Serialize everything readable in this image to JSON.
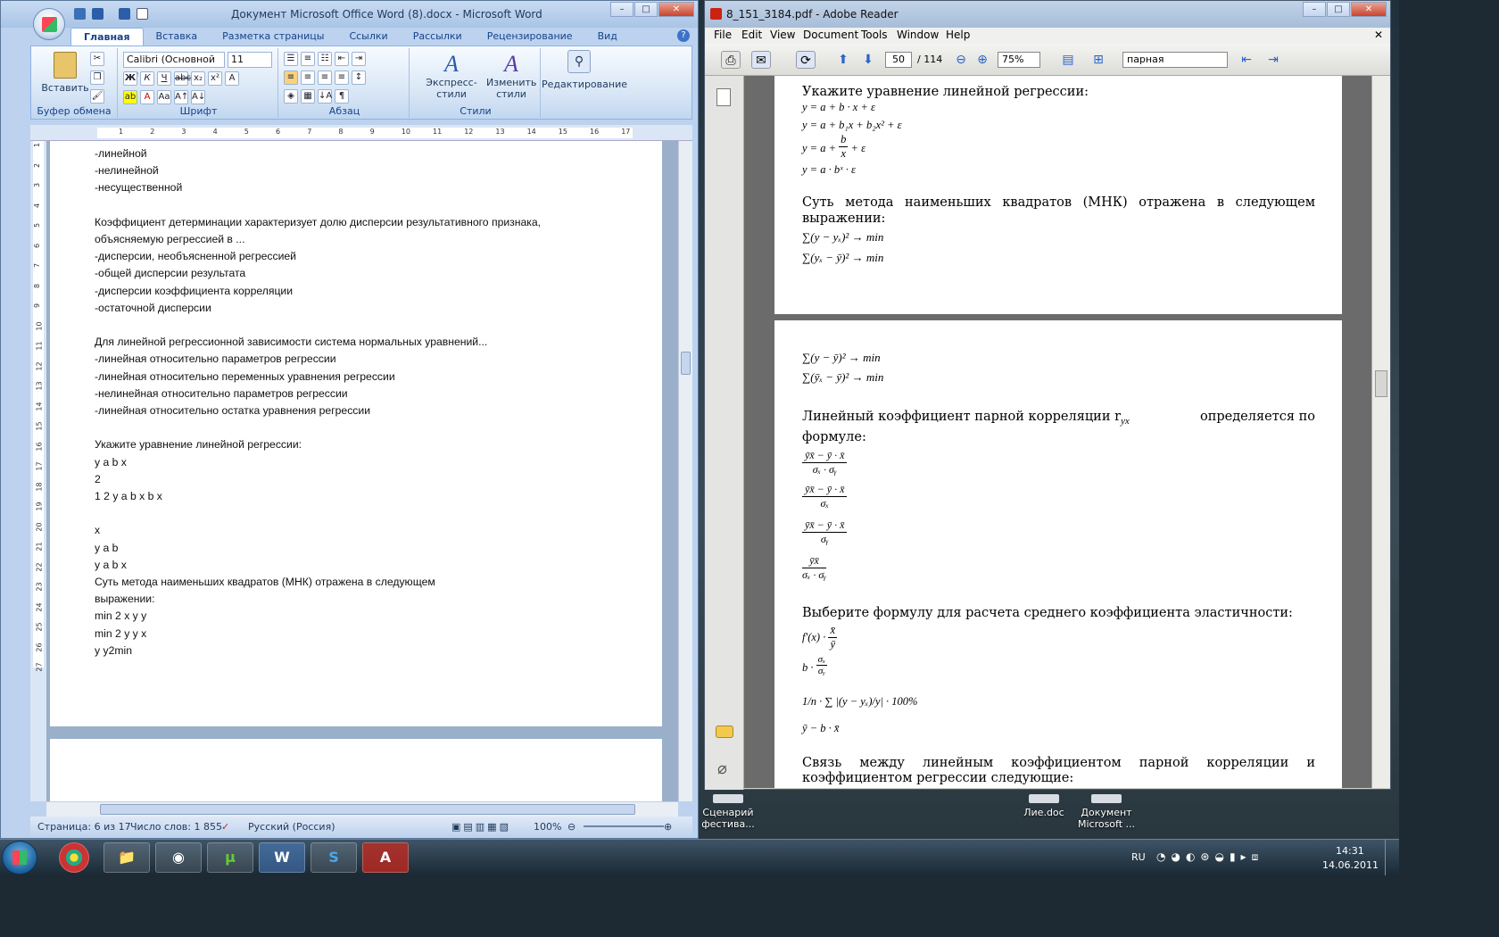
{
  "word": {
    "title": "Документ Microsoft Office Word (8).docx - Microsoft Word",
    "tabs": [
      "Главная",
      "Вставка",
      "Разметка страницы",
      "Ссылки",
      "Рассылки",
      "Рецензирование",
      "Вид"
    ],
    "groups": {
      "clipboard": "Буфер обмена",
      "font": "Шрифт",
      "paragraph": "Абзац",
      "styles": "Стили"
    },
    "paste_label": "Вставить",
    "font_name": "Calibri (Основной те",
    "font_size": "11",
    "express_styles": "Экспресс-стили",
    "change_styles_1": "Изменить",
    "change_styles_2": "стили",
    "editing": "Редактирование",
    "ruler_numbers": [
      "1",
      "2",
      "3",
      "4",
      "5",
      "6",
      "7",
      "8",
      "9",
      "10",
      "11",
      "12",
      "13",
      "14",
      "15",
      "16",
      "17"
    ],
    "vruler_numbers": [
      "1",
      "2",
      "3",
      "4",
      "5",
      "6",
      "7",
      "8",
      "9",
      "10",
      "11",
      "12",
      "13",
      "14",
      "15",
      "16",
      "17",
      "18",
      "19",
      "20",
      "21",
      "22",
      "23",
      "24",
      "25",
      "26",
      "27"
    ],
    "doc_lines": [
      "-линейной",
      "-нелинейной",
      "-несущественной",
      "",
      "Коэффициент детерминации характеризует долю дисперсии результативного признака,",
      "объясняемую регрессией в ...",
      "-дисперсии, необъясненной регрессией",
      "-общей дисперсии результата",
      "-дисперсии коэффициента корреляции",
      "-остаточной дисперсии",
      "",
      "Для линейной регрессионной зависимости система нормальных уравнений...",
      "-линейная относительно параметров регрессии",
      "-линейная относительно переменных уравнения регрессии",
      "-нелинейная относительно параметров регрессии",
      "-линейная относительно остатка уравнения регрессии",
      "",
      "Укажите уравнение линейной регрессии:",
      "y  a  b x ",
      "   2 ",
      "1 2 y a b x b x",
      "  ",
      "x",
      "y a b",
      "y  a b x ",
      "Суть метода наименьших квадратов (МНК) отражена в следующем",
      "выражении:",
      "  min 2    x y y",
      "  min 2  y  y  x",
      "y  y2min"
    ],
    "status": {
      "page": "Страница: 6 из 17",
      "words": "Число слов: 1 855",
      "lang": "Русский (Россия)",
      "zoom": "100%"
    }
  },
  "reader": {
    "title": "8_151_3184.pdf - Adobe Reader",
    "menu": [
      "File",
      "Edit",
      "View",
      "Document",
      "Tools",
      "Window",
      "Help"
    ],
    "page_current": "50",
    "page_total": "/ 114",
    "zoom": "75%",
    "search_text": "парная",
    "page1": {
      "q1": "Укажите уравнение линейной регрессии:",
      "f1": "y = a + b · x + ε",
      "f2": "y = a + b₁x + b₂x² + ε",
      "f3a": "y = a +",
      "f3num": "b",
      "f3den": "x",
      "f3b": "+ ε",
      "f4": "y = a · bˣ · ε",
      "q2a": "Суть  метода  наименьших  квадратов  (МНК)  отражена  в  следующем",
      "q2b": "выражении:",
      "f5": "∑(y − yₓ)² → min",
      "f6": "∑(yₓ − ȳ)² → min"
    },
    "page2": {
      "f7": "∑(y − ȳ)² → min",
      "f8": "∑(ȳₓ − ȳ)² → min",
      "q3a": "Линейный   коэффициент   парной   корреляции   r",
      "q3sub": "yx",
      "q3c": "определяется   по",
      "q3b": "формуле:",
      "fr1n": "ȳx̄ − ȳ · x̄",
      "fr1d": "σₓ · σᵧ",
      "fr2n": "ȳx̄ − ȳ · x̄",
      "fr2d": "σₓ",
      "fr3n": "ȳx̄ − ȳ · x̄",
      "fr3d": "σᵧ",
      "fr4n": "ȳx̄",
      "fr4d": "σₓ · σᵧ",
      "q4": "Выберите формулу для расчета среднего коэффициента эластичности:",
      "e1a": "f′(x) ·",
      "e1n": "x̄",
      "e1d": "ȳ",
      "e2a": "b ·",
      "e2n": "σₓ",
      "e2d": "σᵧ",
      "e3a": "1/n · ∑ |(y − yₓ)/y| · 100%",
      "e4": "ȳ − b · x̄",
      "q5a": "Связь   между   линейным   коэффициентом   парной   корреляции   и",
      "q5b": "коэффициентом регрессии следующие:"
    }
  },
  "desktop_icons": [
    {
      "label": "Сценарий фестива..."
    },
    {
      "label": "Лие.doc"
    },
    {
      "label": "Документ Microsoft ..."
    }
  ],
  "taskbar": {
    "lang": "RU",
    "time": "14:31",
    "date": "14.06.2011"
  }
}
